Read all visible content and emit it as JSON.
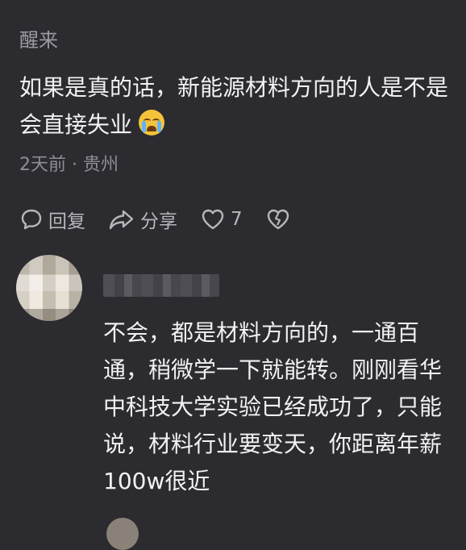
{
  "comment": {
    "username": "醒来",
    "text": "如果是真的话，新能源材料方向的人是不是会直接失业",
    "emoji_icon": "loudly-crying-face-icon",
    "meta": "2天前 · 贵州"
  },
  "actions": {
    "reply_label": "回复",
    "share_label": "分享",
    "like_count": "7"
  },
  "reply": {
    "text": "不会，都是材料方向的，一通百通，稍微学一下就能转。刚刚看华中科技大学实验已经成功了，只能说，材料行业要变天，你距离年薪100w很近"
  },
  "colors": {
    "background": "#2b2b30",
    "primary_text": "#f2f2f4",
    "secondary_text": "#8e8e94"
  }
}
